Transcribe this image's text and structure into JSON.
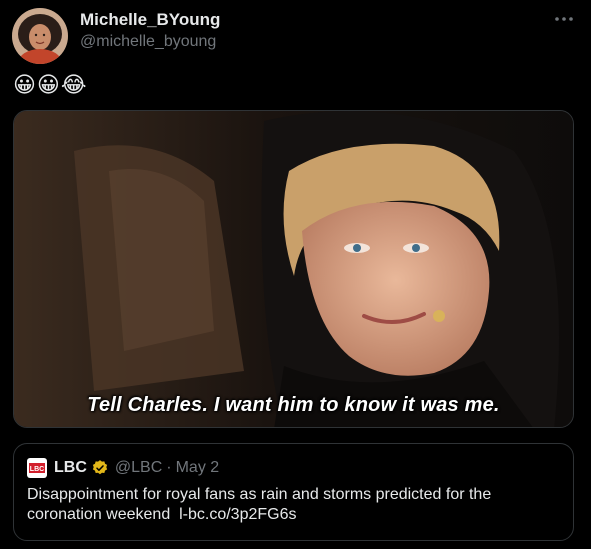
{
  "author": {
    "display_name": "Michelle_BYoung",
    "handle": "@michelle_byoung"
  },
  "tweet": {
    "text": "😀😀😂"
  },
  "media": {
    "caption": "Tell Charles. I want him to know it was me."
  },
  "quote": {
    "logo_text": "LBC",
    "name": "LBC",
    "handle": "@LBC",
    "dot": "·",
    "date": "May 2",
    "text": "Disappointment for royal fans as rain and storms predicted for the coronation weekend",
    "link": "l-bc.co/3p2FG6s"
  },
  "icons": {
    "more": "more-horizontal-icon",
    "verified": "verified-badge-icon"
  },
  "colors": {
    "background": "#000000",
    "text_primary": "#e7e9ea",
    "text_secondary": "#71767b",
    "border": "#2f3336",
    "verified_gold": "#e2b719"
  }
}
